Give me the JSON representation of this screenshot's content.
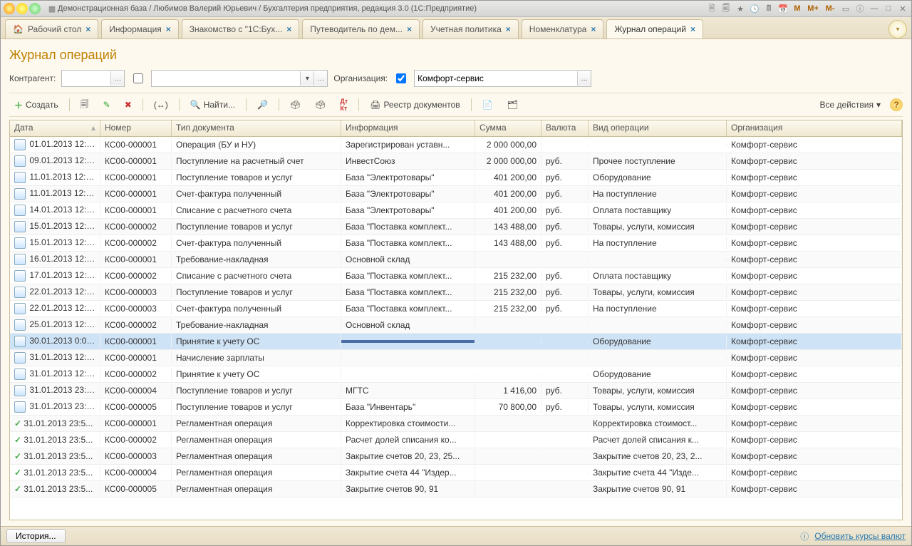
{
  "window": {
    "title": "Демонстрационная база / Любимов Валерий Юрьевич / Бухгалтерия предприятия, редакция 3.0  (1С:Предприятие)"
  },
  "titlebar_right": [
    "M",
    "M+",
    "M-"
  ],
  "tabs": [
    {
      "label": "Рабочий стол",
      "active": false,
      "icon": "desktop"
    },
    {
      "label": "Информация",
      "active": false
    },
    {
      "label": "Знакомство с \"1С:Бух...",
      "active": false
    },
    {
      "label": "Путеводитель по дем...",
      "active": false
    },
    {
      "label": "Учетная политика",
      "active": false
    },
    {
      "label": "Номенклатура",
      "active": false
    },
    {
      "label": "Журнал операций",
      "active": true
    }
  ],
  "page": {
    "title": "Журнал операций"
  },
  "filters": {
    "contragent_label": "Контрагент:",
    "contragent_value": "",
    "extra_checkbox": false,
    "extra_value": "",
    "org_label": "Организация:",
    "org_checked": true,
    "org_value": "Комфорт-сервис"
  },
  "toolbar": {
    "create": "Создать",
    "find": "Найти...",
    "registry": "Реестр документов",
    "all_actions": "Все действия"
  },
  "columns": {
    "date": "Дата",
    "num": "Номер",
    "doctype": "Тип документа",
    "info": "Информация",
    "sum": "Сумма",
    "cur": "Валюта",
    "op": "Вид операции",
    "org": "Организация"
  },
  "rows": [
    {
      "icon": "doc",
      "date": "01.01.2013 12:0...",
      "num": "КС00-000001",
      "doctype": "Операция (БУ и НУ)",
      "info": "Зарегистрирован уставн...",
      "sum": "2 000 000,00",
      "cur": "",
      "op": "",
      "org": "Комфорт-сервис"
    },
    {
      "icon": "doc",
      "date": "09.01.2013 12:0...",
      "num": "КС00-000001",
      "doctype": "Поступление на расчетный счет",
      "info": "ИнвестСоюз",
      "sum": "2 000 000,00",
      "cur": "руб.",
      "op": "Прочее поступление",
      "org": "Комфорт-сервис"
    },
    {
      "icon": "doc",
      "date": "11.01.2013 12:0...",
      "num": "КС00-000001",
      "doctype": "Поступление товаров и услуг",
      "info": "База \"Электротовары\"",
      "sum": "401 200,00",
      "cur": "руб.",
      "op": "Оборудование",
      "org": "Комфорт-сервис"
    },
    {
      "icon": "doc",
      "date": "11.01.2013 12:0...",
      "num": "КС00-000001",
      "doctype": "Счет-фактура полученный",
      "info": "База \"Электротовары\"",
      "sum": "401 200,00",
      "cur": "руб.",
      "op": "На поступление",
      "org": "Комфорт-сервис"
    },
    {
      "icon": "doc",
      "date": "14.01.2013 12:0...",
      "num": "КС00-000001",
      "doctype": "Списание с расчетного счета",
      "info": "База \"Электротовары\"",
      "sum": "401 200,00",
      "cur": "руб.",
      "op": "Оплата поставщику",
      "org": "Комфорт-сервис"
    },
    {
      "icon": "doc",
      "date": "15.01.2013 12:0...",
      "num": "КС00-000002",
      "doctype": "Поступление товаров и услуг",
      "info": "База \"Поставка комплект...",
      "sum": "143 488,00",
      "cur": "руб.",
      "op": "Товары, услуги, комиссия",
      "org": "Комфорт-сервис"
    },
    {
      "icon": "doc",
      "date": "15.01.2013 12:0...",
      "num": "КС00-000002",
      "doctype": "Счет-фактура полученный",
      "info": "База \"Поставка комплект...",
      "sum": "143 488,00",
      "cur": "руб.",
      "op": "На поступление",
      "org": "Комфорт-сервис"
    },
    {
      "icon": "doc",
      "date": "16.01.2013 12:0...",
      "num": "КС00-000001",
      "doctype": "Требование-накладная",
      "info": "Основной склад",
      "sum": "",
      "cur": "",
      "op": "",
      "org": "Комфорт-сервис"
    },
    {
      "icon": "doc",
      "date": "17.01.2013 12:0...",
      "num": "КС00-000002",
      "doctype": "Списание с расчетного счета",
      "info": "База \"Поставка комплект...",
      "sum": "215 232,00",
      "cur": "руб.",
      "op": "Оплата поставщику",
      "org": "Комфорт-сервис"
    },
    {
      "icon": "doc",
      "date": "22.01.2013 12:0...",
      "num": "КС00-000003",
      "doctype": "Поступление товаров и услуг",
      "info": "База \"Поставка комплект...",
      "sum": "215 232,00",
      "cur": "руб.",
      "op": "Товары, услуги, комиссия",
      "org": "Комфорт-сервис"
    },
    {
      "icon": "doc",
      "date": "22.01.2013 12:0...",
      "num": "КС00-000003",
      "doctype": "Счет-фактура полученный",
      "info": "База \"Поставка комплект...",
      "sum": "215 232,00",
      "cur": "руб.",
      "op": "На поступление",
      "org": "Комфорт-сервис"
    },
    {
      "icon": "doc",
      "date": "25.01.2013 12:0...",
      "num": "КС00-000002",
      "doctype": "Требование-накладная",
      "info": "Основной склад",
      "sum": "",
      "cur": "",
      "op": "",
      "org": "Комфорт-сервис"
    },
    {
      "icon": "doc",
      "date": "30.01.2013 0:00...",
      "num": "КС00-000001",
      "doctype": "Принятие к учету ОС",
      "info": "",
      "sum": "",
      "cur": "",
      "op": "Оборудование",
      "org": "Комфорт-сервис",
      "selected": true,
      "selcell": "info"
    },
    {
      "icon": "doc",
      "date": "31.01.2013 12:0...",
      "num": "КС00-000001",
      "doctype": "Начисление зарплаты",
      "info": "",
      "sum": "",
      "cur": "",
      "op": "",
      "org": "Комфорт-сервис"
    },
    {
      "icon": "doc",
      "date": "31.01.2013 12:0...",
      "num": "КС00-000002",
      "doctype": "Принятие к учету ОС",
      "info": "",
      "sum": "",
      "cur": "",
      "op": "Оборудование",
      "org": "Комфорт-сервис"
    },
    {
      "icon": "doc",
      "date": "31.01.2013 23:5...",
      "num": "КС00-000004",
      "doctype": "Поступление товаров и услуг",
      "info": "МГТС",
      "sum": "1 416,00",
      "cur": "руб.",
      "op": "Товары, услуги, комиссия",
      "org": "Комфорт-сервис"
    },
    {
      "icon": "doc",
      "date": "31.01.2013 23:5...",
      "num": "КС00-000005",
      "doctype": "Поступление товаров и услуг",
      "info": "База \"Инвентарь\"",
      "sum": "70 800,00",
      "cur": "руб.",
      "op": "Товары, услуги, комиссия",
      "org": "Комфорт-сервис"
    },
    {
      "icon": "ok",
      "date": "31.01.2013 23:5...",
      "num": "КС00-000001",
      "doctype": "Регламентная операция",
      "info": "Корректировка стоимости...",
      "sum": "",
      "cur": "",
      "op": "Корректировка стоимост...",
      "org": "Комфорт-сервис"
    },
    {
      "icon": "ok",
      "date": "31.01.2013 23:5...",
      "num": "КС00-000002",
      "doctype": "Регламентная операция",
      "info": "Расчет долей списания ко...",
      "sum": "",
      "cur": "",
      "op": "Расчет долей списания к...",
      "org": "Комфорт-сервис"
    },
    {
      "icon": "ok",
      "date": "31.01.2013 23:5...",
      "num": "КС00-000003",
      "doctype": "Регламентная операция",
      "info": "Закрытие счетов 20, 23, 25...",
      "sum": "",
      "cur": "",
      "op": "Закрытие счетов 20, 23, 2...",
      "org": "Комфорт-сервис"
    },
    {
      "icon": "ok",
      "date": "31.01.2013 23:5...",
      "num": "КС00-000004",
      "doctype": "Регламентная операция",
      "info": "Закрытие счета 44 \"Издер...",
      "sum": "",
      "cur": "",
      "op": "Закрытие счета 44 \"Изде...",
      "org": "Комфорт-сервис"
    },
    {
      "icon": "ok",
      "date": "31.01.2013 23:5...",
      "num": "КС00-000005",
      "doctype": "Регламентная операция",
      "info": "Закрытие счетов 90, 91",
      "sum": "",
      "cur": "",
      "op": "Закрытие счетов 90, 91",
      "org": "Комфорт-сервис"
    }
  ],
  "statusbar": {
    "history": "История...",
    "update_link": "Обновить курсы валют"
  }
}
